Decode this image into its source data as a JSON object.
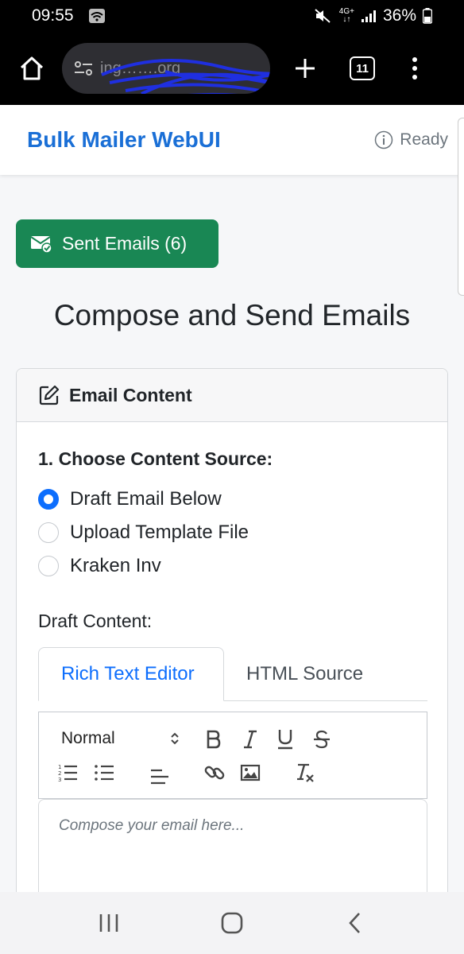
{
  "status_bar": {
    "time": "09:55",
    "network": "4G+",
    "battery": "36%"
  },
  "browser": {
    "url": "ing…….org",
    "tab_count": "11"
  },
  "header": {
    "brand": "Bulk Mailer WebUI",
    "status": "Ready"
  },
  "sent_button": {
    "label": "Sent Emails (6)"
  },
  "page_title": "Compose and Send Emails",
  "card": {
    "title": "Email Content",
    "step_label": "1. Choose Content Source:",
    "options": [
      {
        "label": "Draft Email Below",
        "checked": true
      },
      {
        "label": "Upload Template File",
        "checked": false
      },
      {
        "label": "Kraken Inv",
        "checked": false
      }
    ],
    "draft_label": "Draft Content:",
    "tabs": [
      {
        "label": "Rich Text Editor",
        "active": true
      },
      {
        "label": "HTML Source",
        "active": false
      }
    ],
    "toolbar": {
      "format_select": "Normal"
    },
    "editor": {
      "placeholder": "Compose your email here..."
    }
  },
  "colors": {
    "brand": "#1a6fd6",
    "success": "#198754",
    "primary": "#0d6efd"
  }
}
